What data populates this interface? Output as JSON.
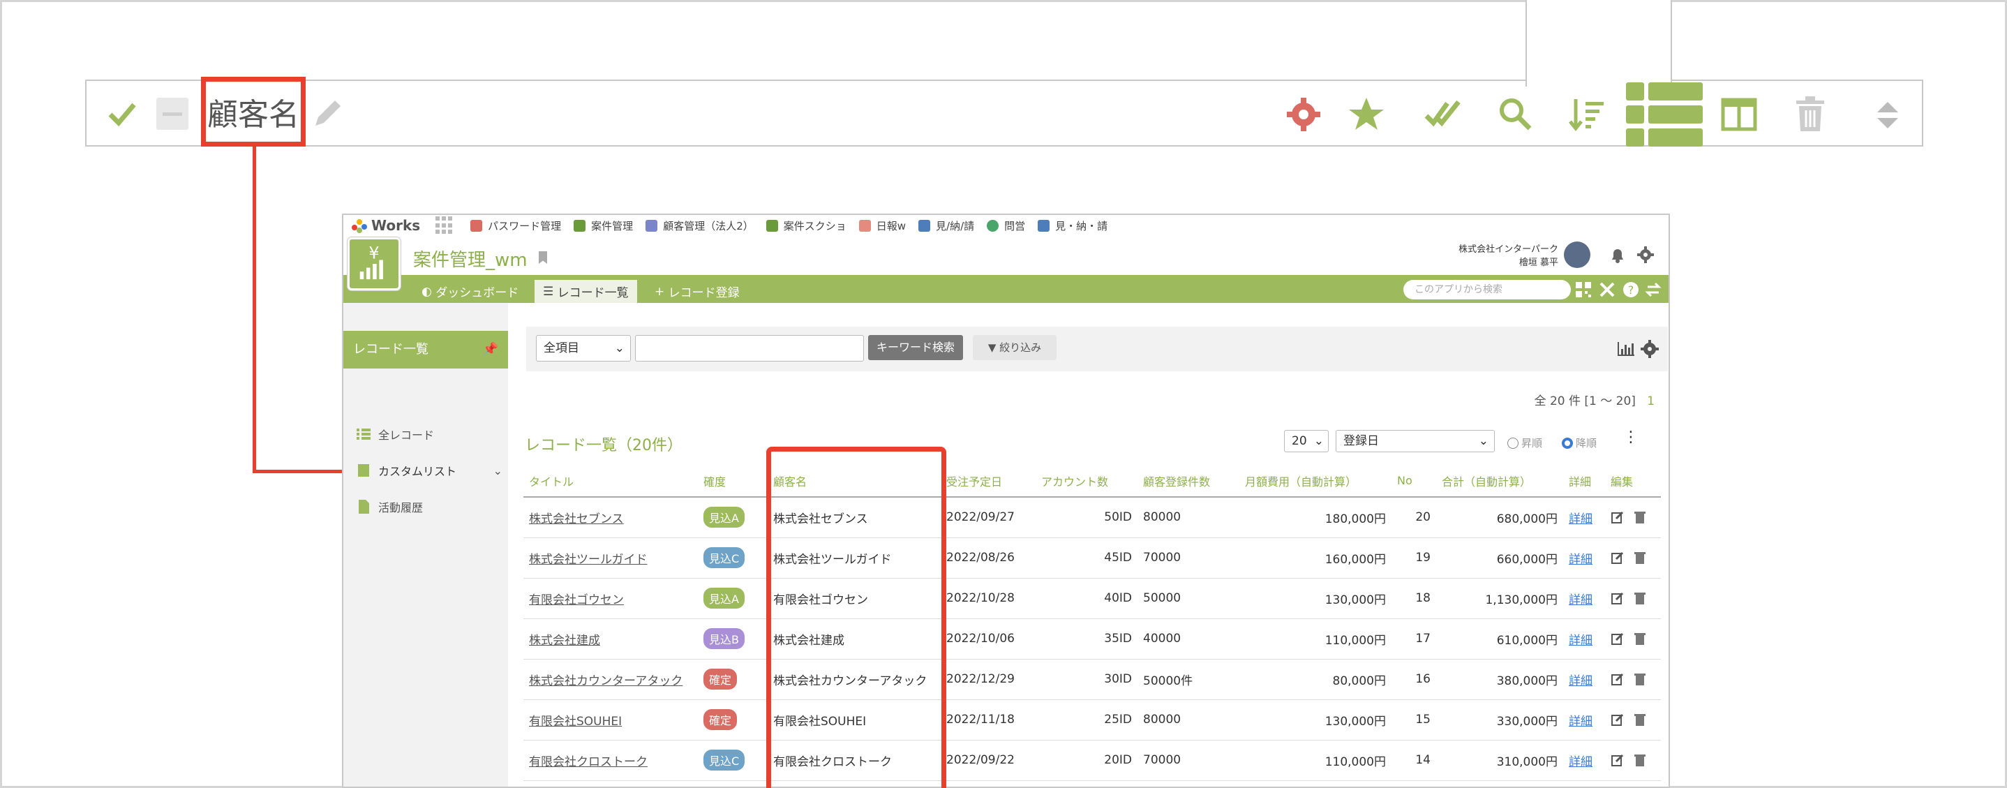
{
  "zoom_toolbar": {
    "field_label": "顧客名",
    "icons": [
      "check-icon",
      "minus-icon",
      "pencil-icon",
      "gear-icon",
      "star-icon",
      "double-check-icon",
      "search-icon",
      "sort-icon",
      "list-view-icon",
      "split-view-icon",
      "trash-icon",
      "updown-icon"
    ]
  },
  "colors": {
    "accent": "#9dba5c",
    "highlight": "#e8402c",
    "title_green": "#8db04a"
  },
  "topnav": {
    "logo": "Works",
    "items": [
      "パスワード管理",
      "案件管理",
      "顧客管理（法人2）",
      "案件スクショ",
      "日報w",
      "見/納/請",
      "問営",
      "見・納・請"
    ]
  },
  "app": {
    "title": "案件管理_wm",
    "company": "株式会社インターパーク",
    "user": "檜垣 慕平",
    "tabs": [
      "ダッシュボード",
      "レコード一覧",
      "レコード登録"
    ],
    "search_placeholder": "このアプリから検索"
  },
  "sidebar": {
    "header": "レコード一覧",
    "items": [
      "全レコード",
      "カスタムリスト",
      "活動履歴"
    ]
  },
  "search": {
    "field_select": "全項目",
    "keyword_button": "キーワード検索",
    "filter_button": "絞り込み"
  },
  "list": {
    "count_text": "全 20 件 [1 〜 20]",
    "page": "1",
    "title": "レコード一覧（20件）",
    "per_page": "20",
    "sort_field": "登録日",
    "asc": "昇順",
    "desc": "降順",
    "columns": [
      "タイトル",
      "確度",
      "顧客名",
      "受注予定日",
      "アカウント数",
      "顧客登録件数",
      "月額費用（自動計算）",
      "No",
      "合計（自動計算）",
      "詳細",
      "編集"
    ],
    "rows": [
      {
        "title": "株式会社セブンス",
        "rank": "見込A",
        "rank_color": "#9dba5c",
        "customer": "株式会社セブンス",
        "date": "2022/09/27",
        "accounts": "50ID",
        "regs": "80000",
        "monthly": "180,000円",
        "no": "20",
        "total": "680,000円",
        "detail": "詳細"
      },
      {
        "title": "株式会社ツールガイド",
        "rank": "見込C",
        "rank_color": "#6ea2c6",
        "customer": "株式会社ツールガイド",
        "date": "2022/08/26",
        "accounts": "45ID",
        "regs": "70000",
        "monthly": "160,000円",
        "no": "19",
        "total": "660,000円",
        "detail": "詳細"
      },
      {
        "title": "有限会社ゴウセン",
        "rank": "見込A",
        "rank_color": "#9dba5c",
        "customer": "有限会社ゴウセン",
        "date": "2022/10/28",
        "accounts": "40ID",
        "regs": "50000",
        "monthly": "130,000円",
        "no": "18",
        "total": "1,130,000円",
        "detail": "詳細"
      },
      {
        "title": "株式会社建成",
        "rank": "見込B",
        "rank_color": "#a88fd6",
        "customer": "株式会社建成",
        "date": "2022/10/06",
        "accounts": "35ID",
        "regs": "40000",
        "monthly": "110,000円",
        "no": "17",
        "total": "610,000円",
        "detail": "詳細"
      },
      {
        "title": "株式会社カウンターアタック",
        "rank": "確定",
        "rank_color": "#d96b63",
        "customer": "株式会社カウンターアタック",
        "date": "2022/12/29",
        "accounts": "30ID",
        "regs": "50000件",
        "monthly": "80,000円",
        "no": "16",
        "total": "380,000円",
        "detail": "詳細"
      },
      {
        "title": "有限会社SOUHEI",
        "rank": "確定",
        "rank_color": "#d96b63",
        "customer": "有限会社SOUHEI",
        "date": "2022/11/18",
        "accounts": "25ID",
        "regs": "80000",
        "monthly": "130,000円",
        "no": "15",
        "total": "330,000円",
        "detail": "詳細"
      },
      {
        "title": "有限会社クロストーク",
        "rank": "見込C",
        "rank_color": "#6ea2c6",
        "customer": "有限会社クロストーク",
        "date": "2022/09/22",
        "accounts": "20ID",
        "regs": "70000",
        "monthly": "110,000円",
        "no": "14",
        "total": "310,000円",
        "detail": "詳細"
      }
    ]
  }
}
